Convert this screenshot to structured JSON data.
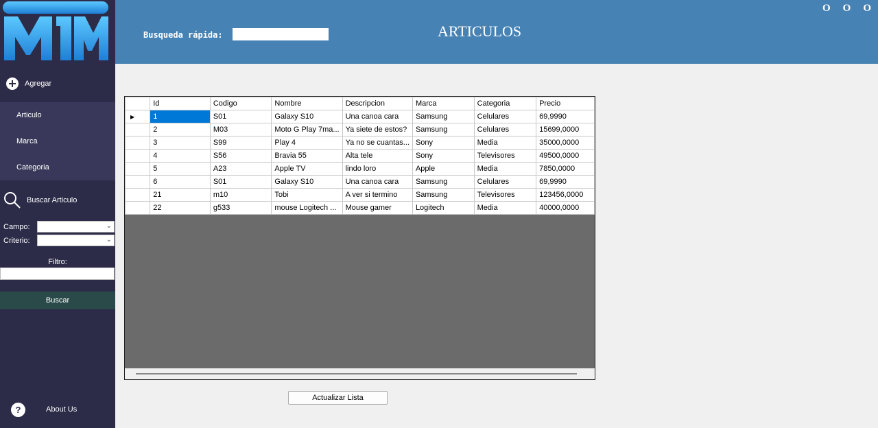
{
  "header": {
    "quick_search_label": "Busqueda rápida:",
    "title": "ARTICULOS",
    "window_controls": [
      "O",
      "O",
      "O"
    ]
  },
  "sidebar": {
    "logo_text": "MTM",
    "add_label": "Agregar",
    "submenu": [
      "Articulo",
      "Marca",
      "Categoria"
    ],
    "search_label": "Buscar Articulo",
    "campo_label": "Campo:",
    "criterio_label": "Criterio:",
    "filtro_label": "Filtro:",
    "buscar_button": "Buscar",
    "about_label": "About Us"
  },
  "grid": {
    "columns": [
      "Id",
      "Codigo",
      "Nombre",
      "Descripcion",
      "Marca",
      "Categoria",
      "Precio"
    ],
    "rows": [
      [
        "1",
        "S01",
        "Galaxy S10",
        "Una canoa cara",
        "Samsung",
        "Celulares",
        "69,9990"
      ],
      [
        "2",
        "M03",
        "Moto G Play 7ma...",
        "Ya siete de estos?",
        "Samsung",
        "Celulares",
        "15699,0000"
      ],
      [
        "3",
        "S99",
        "Play 4",
        "Ya no se cuantas...",
        "Sony",
        "Media",
        "35000,0000"
      ],
      [
        "4",
        "S56",
        "Bravia 55",
        "Alta tele",
        "Sony",
        "Televisores",
        "49500,0000"
      ],
      [
        "5",
        "A23",
        "Apple TV",
        "lindo loro",
        "Apple",
        "Media",
        "7850,0000"
      ],
      [
        "6",
        "S01",
        "Galaxy S10",
        "Una canoa cara",
        "Samsung",
        "Celulares",
        "69,9990"
      ],
      [
        "21",
        " m10",
        " Tobi",
        " A ver si termino",
        "Samsung",
        "Televisores",
        "123456,0000"
      ],
      [
        "22",
        "g533",
        "mouse Logitech ...",
        " Mouse gamer",
        "Logitech",
        "Media",
        "40000,0000"
      ]
    ],
    "selected_row": 0
  },
  "refresh_button": "Actualizar Lista",
  "colors": {
    "header": "#4682b4",
    "sidebar": "#2c2b48",
    "selection": "#0078d7"
  }
}
